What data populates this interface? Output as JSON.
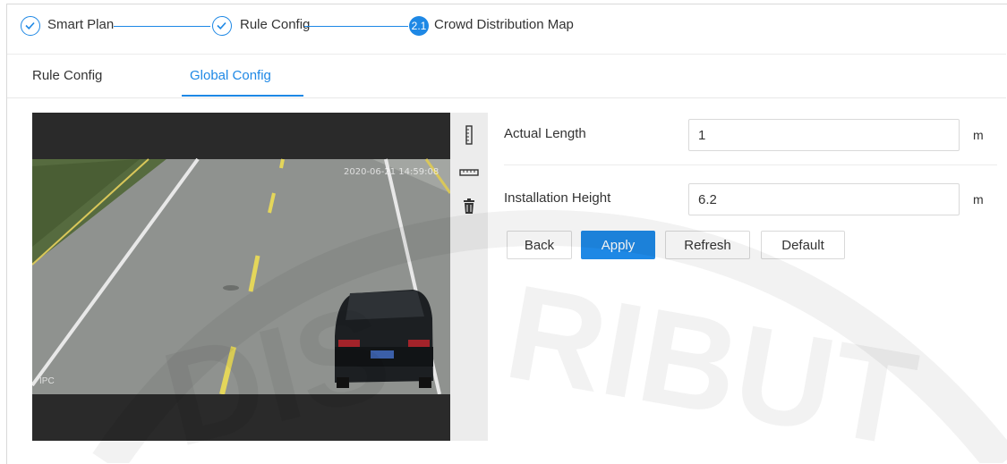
{
  "stepper": {
    "steps": [
      {
        "label": "Smart Plan",
        "state": "done"
      },
      {
        "label": "Rule Config",
        "state": "done"
      },
      {
        "label": "Crowd Distribution Map",
        "state": "active",
        "number": "2.1"
      }
    ]
  },
  "tabs": [
    {
      "label": "Rule Config",
      "active": false
    },
    {
      "label": "Global Config",
      "active": true
    }
  ],
  "video": {
    "timestamp": "2020-06-21 14:59:08",
    "channel_label": "IPC"
  },
  "tools": [
    {
      "icon": "vertical-ruler-icon"
    },
    {
      "icon": "horizontal-ruler-icon"
    },
    {
      "icon": "trash-icon"
    }
  ],
  "form": {
    "actual_length": {
      "label": "Actual Length",
      "value": "1",
      "unit": "m"
    },
    "installation_height": {
      "label": "Installation Height",
      "value": "6.2",
      "unit": "m"
    }
  },
  "buttons": {
    "back": "Back",
    "apply": "Apply",
    "refresh": "Refresh",
    "default": "Default"
  },
  "colors": {
    "accent": "#1e88e5"
  }
}
